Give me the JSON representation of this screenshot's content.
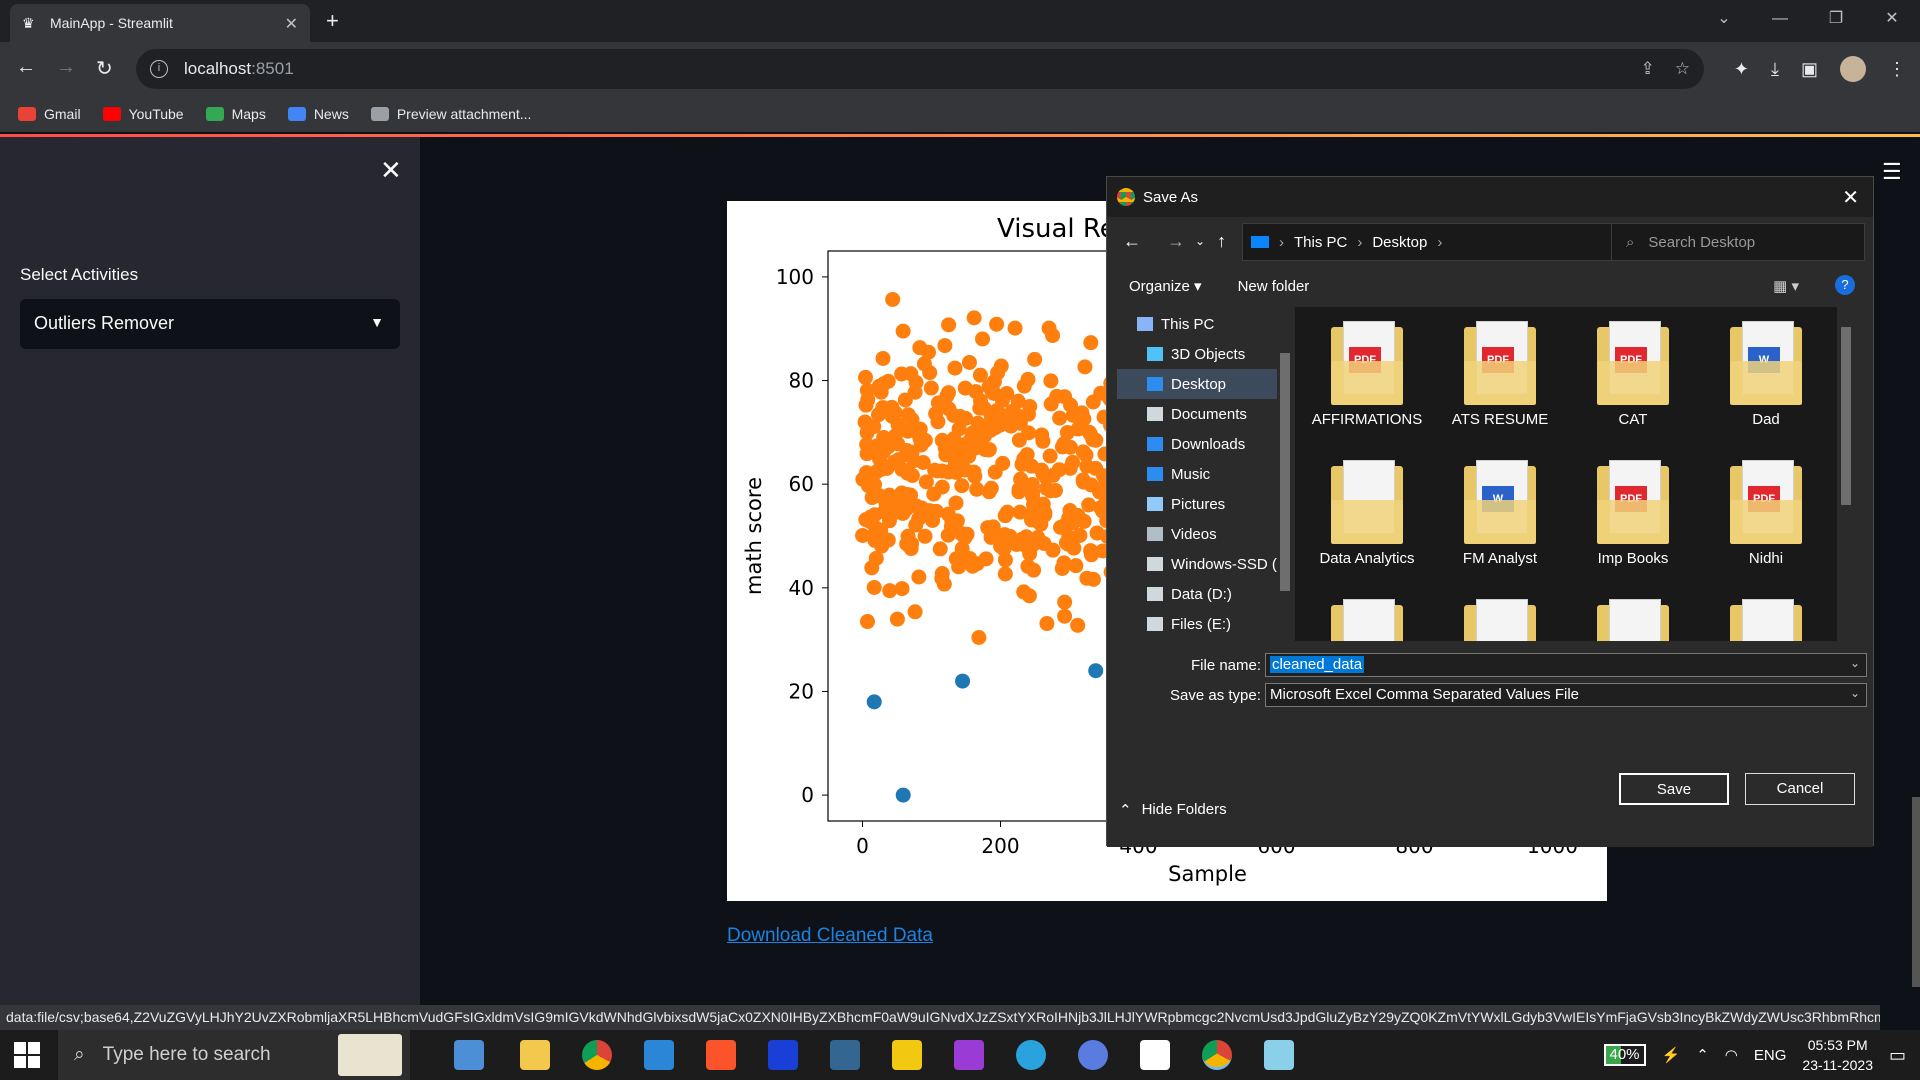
{
  "browser": {
    "tab_title": "MainApp - Streamlit",
    "url_host": "localhost",
    "url_port": ":8501",
    "bookmarks": [
      {
        "label": "Gmail",
        "icon": "gmail-icon",
        "color": "#ea4335"
      },
      {
        "label": "YouTube",
        "icon": "youtube-icon",
        "color": "#ff0000"
      },
      {
        "label": "Maps",
        "icon": "maps-icon",
        "color": "#34a853"
      },
      {
        "label": "News",
        "icon": "news-icon",
        "color": "#4285f4"
      },
      {
        "label": "Preview attachment...",
        "icon": "globe-icon",
        "color": "#9aa0a6"
      }
    ],
    "status_url": "data:file/csv;base64,Z2VuZGVyLHJhY2UvZXRobmljaXR5LHBhcmVudGFsIGxldmVsIG9mIGVkdWNhdGlvbixsdW5jaCx0ZXN0IHByZXBhcmF0aW9uIGNvdXJzZSxtYXRoIHNjb3JlLHJlYWRpbmcgc2NvcmUsd3JpdGluZyBzY29yZQ0KZmVtYWxlLGdyb3VwIEIsYmFjaGVsb3IncyBkZWdyZWUsc3RhbmRhcmQsbm9uZSw3MiwzMywgNjUsNzQNCmZlbWFsZSxncm91cCBDLHNvbWUgY29sbGVnZSxzdGFuZGFyZCxjb21wbGV0ZWQsNjksOTAsODgNCmZlbWFsZSxncm91cCBCLG1hc3RlcidzIGRlZ3JlZSxzdGFuZGFyZCxub25lLDkwLDk1LDkzDQptYWxlLGdyb3VwIEEsYXNzb2NpYXRlJ3MgZGVncmVlLGZyZWUvcmVkdWNlZCxub25lLDQ3LDU3LDQ0DQo=Rhb..."
  },
  "sidebar": {
    "label": "Select Activities",
    "selected": "Outliers Remover"
  },
  "main": {
    "download_link": "Download Cleaned Data"
  },
  "chart_data": {
    "type": "scatter",
    "title": "Visual Re",
    "xlabel": "Sample",
    "ylabel": "math score",
    "xlim": [
      -50,
      1050
    ],
    "ylim": [
      -5,
      105
    ],
    "xticks": [
      "0",
      "200",
      "400",
      "600",
      "800",
      "1000"
    ],
    "yticks": [
      "0",
      "20",
      "40",
      "60",
      "80",
      "100"
    ],
    "series": [
      {
        "role": "inliers",
        "color": "#ff7f0e",
        "count": 990
      },
      {
        "role": "outliers",
        "color": "#1f77b4",
        "x": [
          17,
          59,
          145,
          338
        ],
        "y": [
          18,
          0,
          22,
          24
        ]
      }
    ]
  },
  "dialog": {
    "title": "Save As",
    "breadcrumb": [
      "This PC",
      "Desktop"
    ],
    "search_placeholder": "Search Desktop",
    "organize": "Organize",
    "new_folder": "New folder",
    "tree": [
      {
        "label": "This PC",
        "icon": "pc-icon"
      },
      {
        "label": "3D Objects",
        "icon": "cube-icon"
      },
      {
        "label": "Desktop",
        "icon": "desktop-icon"
      },
      {
        "label": "Documents",
        "icon": "documents-icon"
      },
      {
        "label": "Downloads",
        "icon": "download-icon"
      },
      {
        "label": "Music",
        "icon": "music-icon"
      },
      {
        "label": "Pictures",
        "icon": "pictures-icon"
      },
      {
        "label": "Videos",
        "icon": "videos-icon"
      },
      {
        "label": "Windows-SSD (",
        "icon": "drive-icon"
      },
      {
        "label": "Data (D:)",
        "icon": "drive-icon"
      },
      {
        "label": "Files (E:)",
        "icon": "drive-icon"
      }
    ],
    "files": [
      {
        "label": "AFFIRMATIONS",
        "badge": "PDF",
        "badge_color": "#e0282e"
      },
      {
        "label": "ATS RESUME",
        "badge": "PDF",
        "badge_color": "#e0282e"
      },
      {
        "label": "CAT",
        "badge": "PDF",
        "badge_color": "#e0282e"
      },
      {
        "label": "Dad",
        "badge": "W",
        "badge_color": "#2b62c9"
      },
      {
        "label": "Data Analytics",
        "badge": "",
        "badge_color": "#e8c766"
      },
      {
        "label": "FM Analyst",
        "badge": "W",
        "badge_color": "#2b62c9"
      },
      {
        "label": "Imp Books",
        "badge": "PDF",
        "badge_color": "#e0282e"
      },
      {
        "label": "Nidhi",
        "badge": "PDF",
        "badge_color": "#e0282e"
      }
    ],
    "file_name_label": "File name:",
    "file_name": "cleaned_data",
    "save_type_label": "Save as type:",
    "save_type": "Microsoft Excel Comma Separated Values File",
    "hide_folders": "Hide Folders",
    "save": "Save",
    "cancel": "Cancel"
  },
  "taskbar": {
    "search_placeholder": "Type here to search",
    "battery": "40%",
    "language": "ENG",
    "time": "05:53 PM",
    "date": "23-11-2023"
  }
}
